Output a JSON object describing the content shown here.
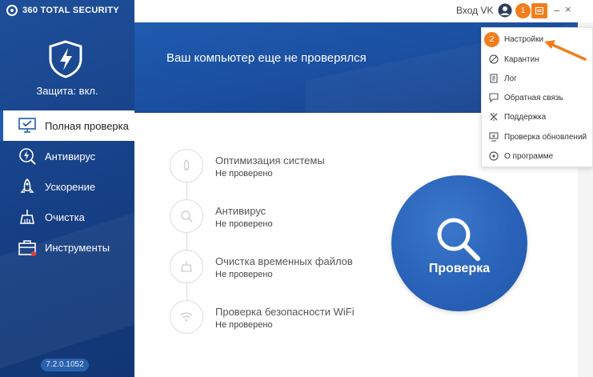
{
  "app": {
    "brand": "360 TOTAL SECURITY",
    "protection_status": "Защита: вкл.",
    "version": "7.2.0.1052"
  },
  "titlebar": {
    "login_label": "Вход VK",
    "minimize": "–",
    "close": "×"
  },
  "annotations": {
    "badge1": "1",
    "badge2": "2"
  },
  "sidebar": {
    "items": [
      {
        "label": "Полная проверка",
        "icon": "monitor-check-icon",
        "active": true
      },
      {
        "label": "Антивирус",
        "icon": "lightning-search-icon",
        "active": false
      },
      {
        "label": "Ускорение",
        "icon": "rocket-icon",
        "active": false
      },
      {
        "label": "Очистка",
        "icon": "broom-icon",
        "active": false
      },
      {
        "label": "Инструменты",
        "icon": "toolbox-icon",
        "active": false
      }
    ]
  },
  "banner": {
    "title": "Ваш компьютер еще не проверялся"
  },
  "steps": [
    {
      "title": "Оптимизация системы",
      "status": "Не проверено",
      "icon": "rocket-outline-icon"
    },
    {
      "title": "Антивирус",
      "status": "Не проверено",
      "icon": "magnifier-outline-icon"
    },
    {
      "title": "Очистка временных файлов",
      "status": "Не проверено",
      "icon": "broom-outline-icon"
    },
    {
      "title": "Проверка безопасности WiFi",
      "status": "Не проверено",
      "icon": "wifi-outline-icon"
    }
  ],
  "scan_button": {
    "label": "Проверка"
  },
  "menu": {
    "items": [
      {
        "label": "Настройки",
        "icon": "gear-icon"
      },
      {
        "label": "Карантин",
        "icon": "prohibited-icon"
      },
      {
        "label": "Лог",
        "icon": "document-icon"
      },
      {
        "label": "Обратная связь",
        "icon": "chat-icon"
      },
      {
        "label": "Поддержка",
        "icon": "tools-icon"
      },
      {
        "label": "Проверка обновлений",
        "icon": "update-icon"
      },
      {
        "label": "О программе",
        "icon": "info-logo-icon"
      }
    ]
  },
  "colors": {
    "sidebar": "#1a4a96",
    "accent_orange": "#f07e1e",
    "scan_blue": "#2861b7"
  }
}
